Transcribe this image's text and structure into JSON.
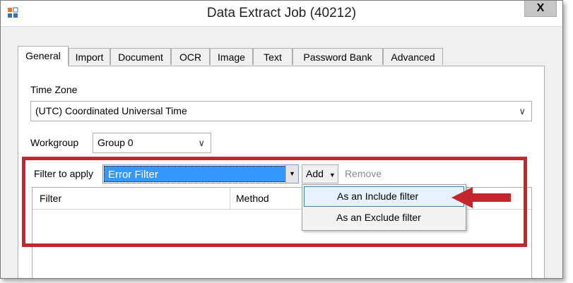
{
  "window": {
    "title": "Data Extract Job (40212)",
    "close_label": "X"
  },
  "tabs": [
    {
      "label": "General",
      "active": true
    },
    {
      "label": "Import"
    },
    {
      "label": "Document"
    },
    {
      "label": "OCR"
    },
    {
      "label": "Image"
    },
    {
      "label": "Text"
    },
    {
      "label": "Password Bank"
    },
    {
      "label": "Advanced"
    }
  ],
  "general": {
    "time_zone_label": "Time Zone",
    "time_zone_value": "(UTC) Coordinated Universal Time",
    "workgroup_label": "Workgroup",
    "workgroup_value": "Group 0",
    "filter_label": "Filter to apply",
    "filter_value": "Error Filter",
    "add_label": "Add",
    "remove_label": "Remove",
    "grid_columns": [
      "Filter",
      "Method"
    ]
  },
  "add_menu": {
    "items": [
      "As an Include filter",
      "As an Exclude filter"
    ]
  },
  "annotation": {
    "highlight_color": "#c1272d"
  }
}
